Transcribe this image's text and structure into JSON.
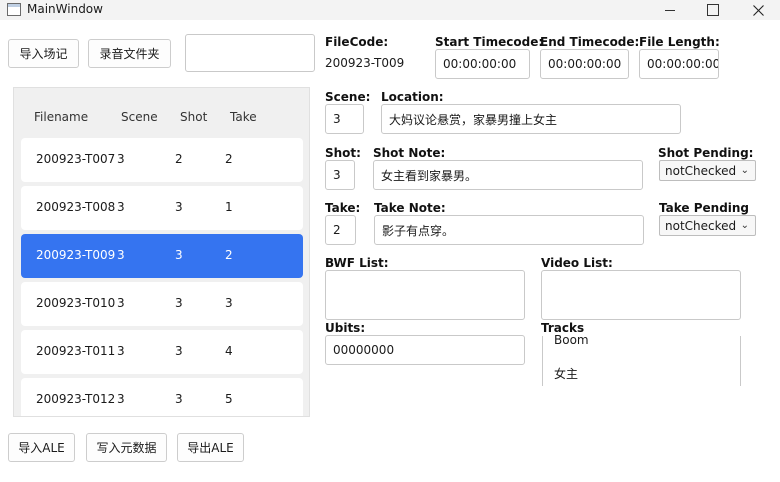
{
  "window": {
    "title": "MainWindow"
  },
  "toolbar": {
    "import_log_label": "导入场记",
    "audio_folder_label": "录音文件夹",
    "path_value": ""
  },
  "list": {
    "headers": [
      "Filename",
      "Scene",
      "Shot",
      "Take"
    ],
    "rows": [
      {
        "filename": "200923-T007",
        "scene": "3",
        "shot": "2",
        "take": "2"
      },
      {
        "filename": "200923-T008",
        "scene": "3",
        "shot": "3",
        "take": "1"
      },
      {
        "filename": "200923-T009",
        "scene": "3",
        "shot": "3",
        "take": "2"
      },
      {
        "filename": "200923-T010",
        "scene": "3",
        "shot": "3",
        "take": "3"
      },
      {
        "filename": "200923-T011",
        "scene": "3",
        "shot": "3",
        "take": "4"
      },
      {
        "filename": "200923-T012",
        "scene": "3",
        "shot": "3",
        "take": "5"
      }
    ],
    "selected_index": 2
  },
  "bottom": {
    "import_ale_label": "导入ALE",
    "write_meta_label": "写入元数据",
    "export_ale_label": "导出ALE"
  },
  "detail": {
    "filecode_label": "FileCode:",
    "filecode_value": "200923-T009",
    "start_tc_label": "Start Timecode:",
    "start_tc_value": "00:00:00:00",
    "end_tc_label": "End Timecode:",
    "end_tc_value": "00:00:00:00",
    "file_length_label": "File Length:",
    "file_length_value": "00:00:00:00",
    "scene_label": "Scene:",
    "scene_value": "3",
    "location_label": "Location:",
    "location_value": "大妈议论悬赏，家暴男撞上女主",
    "shot_label": "Shot:",
    "shot_value": "3",
    "shot_note_label": "Shot Note:",
    "shot_note_value": "女主看到家暴男。",
    "shot_pending_label": "Shot Pending:",
    "shot_pending_value": "notChecked",
    "take_label": "Take:",
    "take_value": "2",
    "take_note_label": "Take Note:",
    "take_note_value": "影子有点穿。",
    "take_pending_label": "Take Pending",
    "take_pending_value": "notChecked",
    "bwf_list_label": "BWF List:",
    "video_list_label": "Video List:",
    "ubits_label": "Ubits:",
    "ubits_value": "00000000",
    "tracks_label": "Tracks",
    "tracks": [
      "Boom",
      "女主"
    ]
  },
  "icons": {
    "app": "window-icon",
    "minimize": "minimize-icon",
    "maximize": "maximize-icon",
    "close": "close-icon",
    "dropdown": "chevron-down-icon"
  },
  "colors": {
    "selection": "#3574f0",
    "list_background": "#f0f0f0",
    "titlebar": "#f3f3f3"
  }
}
